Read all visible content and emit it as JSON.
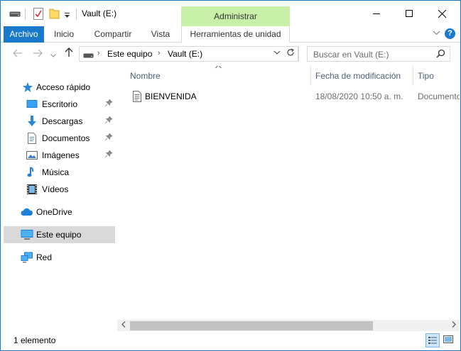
{
  "window": {
    "title": "Vault (E:)",
    "context_tab_group": "Administrar"
  },
  "ribbon": {
    "tabs": [
      {
        "label": "Archivo"
      },
      {
        "label": "Inicio"
      },
      {
        "label": "Compartir"
      },
      {
        "label": "Vista"
      },
      {
        "label": "Herramientas de unidad"
      }
    ]
  },
  "address": {
    "segments": [
      "Este equipo",
      "Vault (E:)"
    ]
  },
  "search": {
    "placeholder": "Buscar en Vault (E:)"
  },
  "navpane": {
    "quick_access": "Acceso rápido",
    "items": [
      {
        "label": "Escritorio",
        "icon": "desktop-icon",
        "pinned": true
      },
      {
        "label": "Descargas",
        "icon": "downloads-icon",
        "pinned": true
      },
      {
        "label": "Documentos",
        "icon": "documents-icon",
        "pinned": true
      },
      {
        "label": "Imágenes",
        "icon": "pictures-icon",
        "pinned": true
      },
      {
        "label": "Música",
        "icon": "music-icon",
        "pinned": false
      },
      {
        "label": "Vídeos",
        "icon": "videos-icon",
        "pinned": false
      }
    ],
    "onedrive": "OneDrive",
    "this_pc": "Este equipo",
    "network": "Red"
  },
  "content": {
    "columns": [
      "Nombre",
      "Fecha de modificación",
      "Tipo"
    ],
    "files": [
      {
        "name": "BIENVENIDA",
        "modified": "18/08/2020 10:50 a. m.",
        "type": "Documento"
      }
    ]
  },
  "status": {
    "count": "1 elemento"
  },
  "colors": {
    "accent": "#1979ca",
    "context_tab": "#c8f0a8",
    "selected_nav": "#d9d9d9"
  }
}
